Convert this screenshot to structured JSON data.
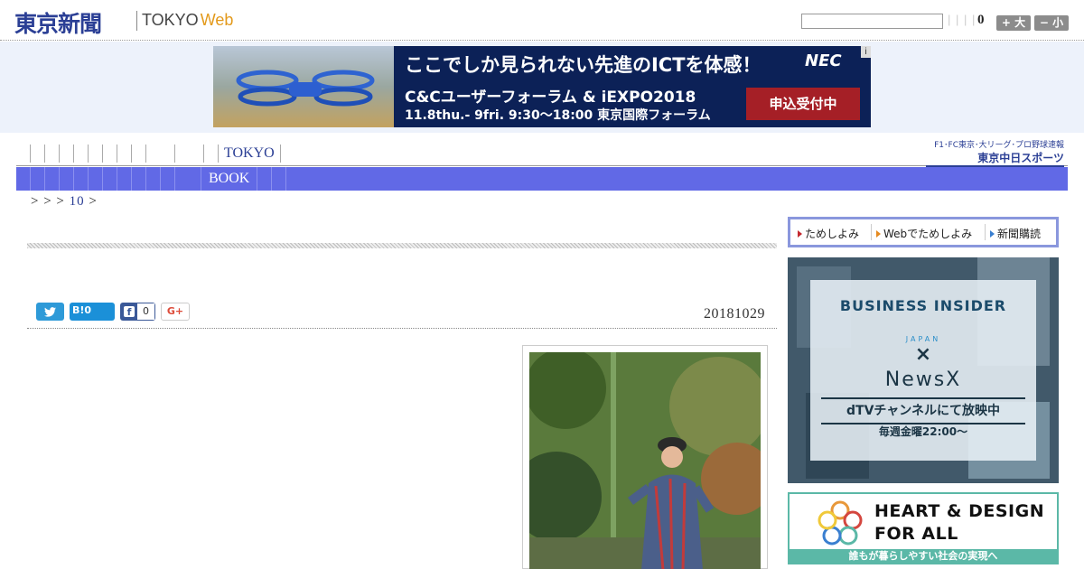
{
  "header": {
    "logo_jp": "東京新聞",
    "logo_en": "TOKYO",
    "logo_web": "Web",
    "search_value": "",
    "pipes": "| | | |",
    "count": "0",
    "font_bigger_label": "+ 大",
    "font_smaller_label": "− 小"
  },
  "banner_ad": {
    "headline": "ここでしか見られない先進のICTを体感！",
    "brand": "NEC",
    "info_icon": "i",
    "event_name": "C&Cユーザーフォーラム & iEXPO2018",
    "event_date": "11.8thu.- 9fri. 9:30〜18:00  東京国際フォーラム",
    "cta": "申込受付中"
  },
  "nav": {
    "primary_label": "TOKYO",
    "secondary_label": "BOOK",
    "chunichi_top": "F1･FC東京･大リーグ･プロ野球速報",
    "chunichi_bottom": "東京中日スポーツ"
  },
  "breadcrumb": {
    "prefix": "> > >",
    "num": "10",
    "suffix": ">"
  },
  "article": {
    "date": "20181029",
    "share": {
      "twitter_icon": "twitter-icon",
      "hatena_label": "B!0",
      "facebook_count": "0",
      "gplus_label": "G+"
    }
  },
  "sidebar": {
    "tabs": [
      {
        "label": "ためしよみ"
      },
      {
        "label": "Webでためしよみ"
      },
      {
        "label": "新聞購読"
      }
    ],
    "ad2": {
      "line1": "BUSINESS INSIDER",
      "line2": "JAPAN",
      "cross": "×",
      "newsx": "NewsX",
      "dtv": "dTVチャンネルにて放映中",
      "week": "毎週金曜22:00〜"
    },
    "ad3": {
      "line1": "HEART & DESIGN",
      "line2": "FOR ALL",
      "footer": "誰もが暮らしやすい社会の実現へ"
    }
  },
  "colors": {
    "brand_blue": "#2b3f95",
    "nav_bar": "#6169e6",
    "web_orange": "#e39a1c",
    "ad_red": "#a51f26",
    "ad3_teal": "#5bb8a7"
  }
}
